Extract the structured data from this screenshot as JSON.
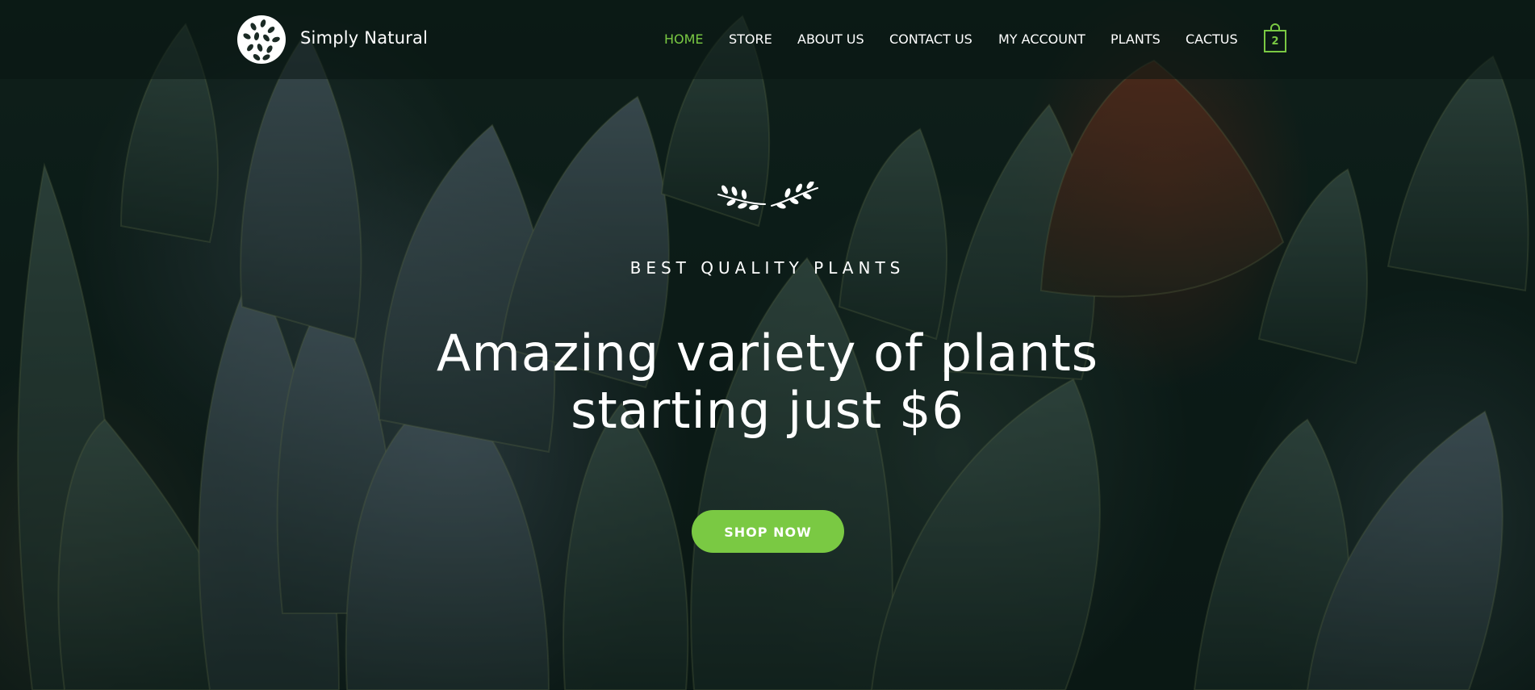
{
  "brand": {
    "name": "Simply Natural",
    "logo_icon": "leaf-medallion-icon"
  },
  "nav": {
    "items": [
      {
        "label": "HOME",
        "active": true
      },
      {
        "label": "STORE",
        "active": false
      },
      {
        "label": "ABOUT US",
        "active": false
      },
      {
        "label": "CONTACT US",
        "active": false
      },
      {
        "label": "MY ACCOUNT",
        "active": false
      },
      {
        "label": "PLANTS",
        "active": false
      },
      {
        "label": "CACTUS",
        "active": false
      }
    ],
    "cart": {
      "icon": "shopping-bag-icon",
      "count": "2"
    }
  },
  "hero": {
    "ornament_icon": "laurel-branch-icon",
    "eyebrow": "BEST QUALITY PLANTS",
    "headline_line1": "Amazing variety of plants",
    "headline_line2": "starting just $6",
    "cta_label": "SHOP NOW"
  },
  "colors": {
    "accent": "#7ac943",
    "text": "#ffffff",
    "background": "#0f201b"
  }
}
